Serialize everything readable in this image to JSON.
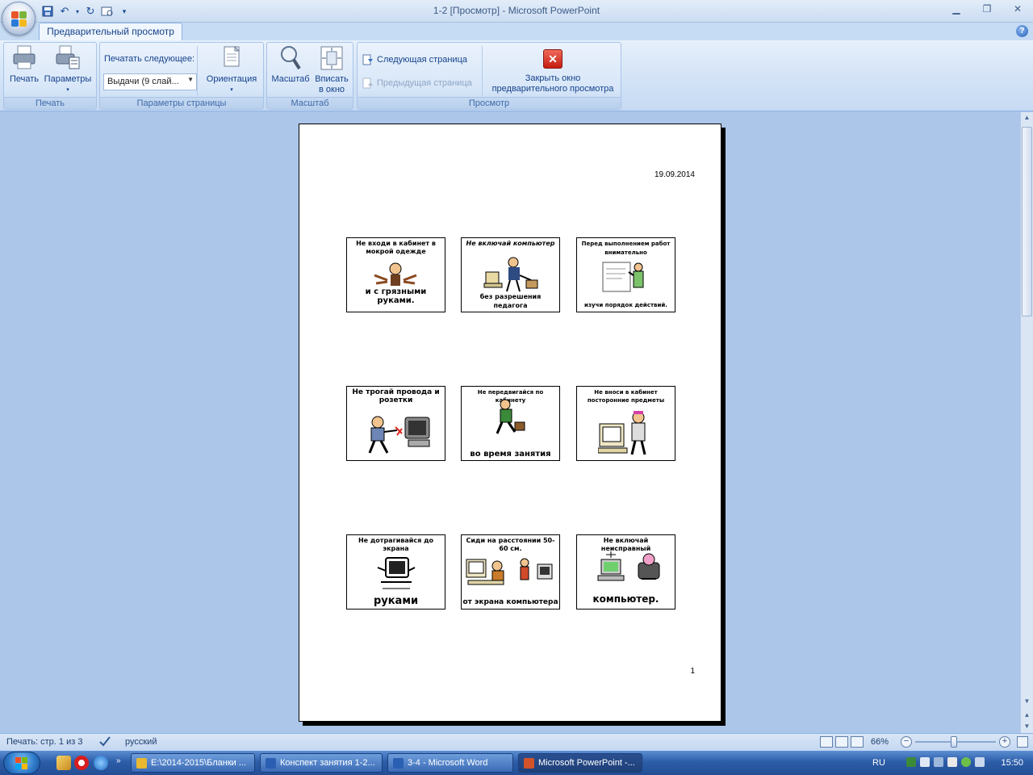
{
  "window": {
    "title": "1-2 [Просмотр] - Microsoft PowerPoint",
    "controls": [
      "minimize-icon",
      "restore-icon",
      "close-icon"
    ]
  },
  "tabs": {
    "active": "Предварительный просмотр"
  },
  "ribbon": {
    "print_group": {
      "label": "Печать",
      "print": "Печать",
      "params": "Параметры"
    },
    "page_setup_group": {
      "label": "Параметры страницы",
      "print_what_label": "Печатать следующее:",
      "print_what_value": "Выдачи (9 слай...",
      "orientation": "Ориентация"
    },
    "zoom_group": {
      "label": "Масштаб",
      "zoom": "Масштаб",
      "fit_line1": "Вписать",
      "fit_line2": "в окно"
    },
    "preview_group": {
      "label": "Просмотр",
      "next_page": "Следующая страница",
      "prev_page": "Предыдущая страница",
      "close_line1": "Закрыть окно",
      "close_line2": "предварительного просмотра"
    }
  },
  "page": {
    "date": "19.09.2014",
    "number": "1",
    "slides": [
      {
        "top": "Не входи в кабинет в мокрой одежде",
        "bottom": "и с грязными руками."
      },
      {
        "top": "Не включай компьютер",
        "bottom": "без разрешения педагога"
      },
      {
        "top": "Перед выполнением работ внимательно",
        "bottom": "изучи порядок действий."
      },
      {
        "top": "Не трогай провода и розетки",
        "bottom": ""
      },
      {
        "top": "Не передвигайся по кабинету",
        "bottom": "во время занятия"
      },
      {
        "top": "Не вноси в кабинет посторонние предметы",
        "bottom": ""
      },
      {
        "top": "Не дотрагивайся до экрана",
        "bottom": "руками"
      },
      {
        "top": "Сиди на расстоянии 50-60 см.",
        "bottom": "от экрана компьютера"
      },
      {
        "top": "Не включай неисправный",
        "bottom": "компьютер."
      }
    ]
  },
  "statusbar": {
    "page_info": "Печать: стр. 1 из 3",
    "language": "русский",
    "zoom": "66%",
    "zoom_level_percent": 66
  },
  "taskbar": {
    "tasks": [
      {
        "label": "E:\\2014-2015\\Бланки ...",
        "color": "#e8b830"
      },
      {
        "label": "Конспект занятия 1-2...",
        "color": "#2b5fb3"
      },
      {
        "label": "3-4 - Microsoft Word",
        "color": "#2b5fb3"
      },
      {
        "label": "Microsoft PowerPoint -...",
        "color": "#d2532a"
      }
    ],
    "language": "RU",
    "clock": "15:50"
  }
}
